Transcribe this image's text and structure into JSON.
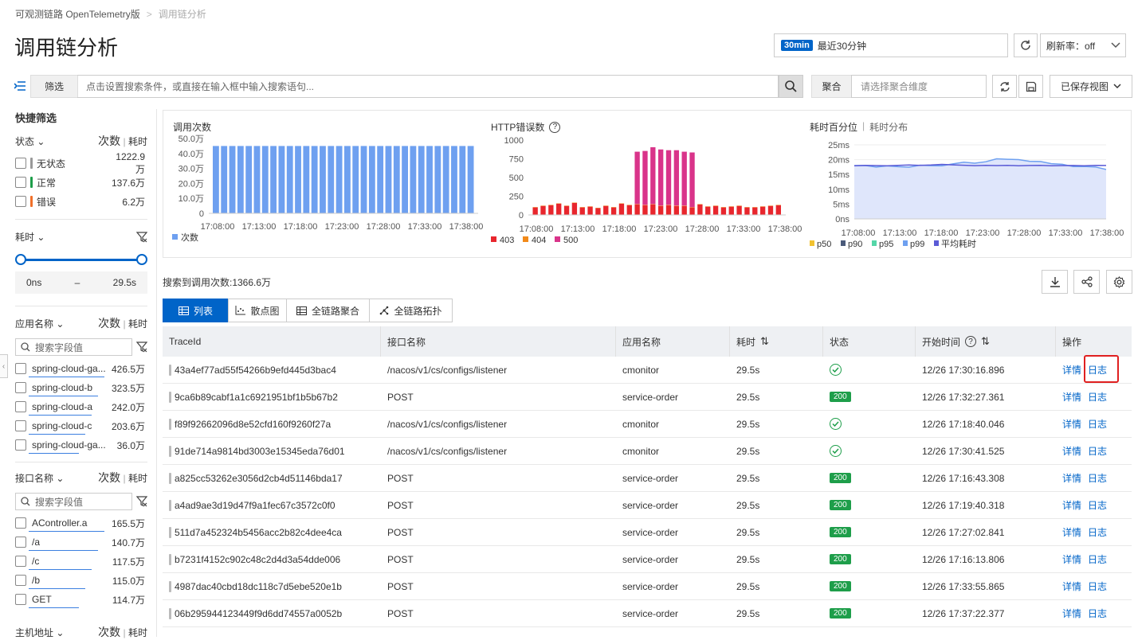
{
  "breadcrumb": {
    "parent": "可观测链路 OpenTelemetry版",
    "sep": ">",
    "current": "调用链分析"
  },
  "page_title": "调用链分析",
  "time": {
    "tag": "30min",
    "label": "最近30分钟"
  },
  "refresh_rate": {
    "label": "刷新率：off"
  },
  "search": {
    "filter_label": "筛选",
    "placeholder": "点击设置搜索条件，或直接在输入框中输入搜索语句..."
  },
  "aggregate": {
    "label": "聚合",
    "placeholder": "请选择聚合维度"
  },
  "saved_view": "已保存视图",
  "sidebar": {
    "title": "快捷筛选",
    "count_word": "次数",
    "sep": "|",
    "time_word": "耗时",
    "status": {
      "label": "状态",
      "items": [
        {
          "label": "无状态",
          "count": "1222.9万",
          "color": "#999999"
        },
        {
          "label": "正常",
          "count": "137.6万",
          "color": "#1e9e4a"
        },
        {
          "label": "错误",
          "count": "6.2万",
          "color": "#f0702a"
        }
      ]
    },
    "duration": {
      "label": "耗时",
      "min": "0ns",
      "dash": "–",
      "max": "29.5s"
    },
    "app": {
      "label": "应用名称",
      "search_placeholder": "搜索字段值",
      "items": [
        {
          "label": "spring-cloud-ga...",
          "count": "426.5万"
        },
        {
          "label": "spring-cloud-b",
          "count": "323.5万"
        },
        {
          "label": "spring-cloud-a",
          "count": "242.0万"
        },
        {
          "label": "spring-cloud-c",
          "count": "203.6万"
        },
        {
          "label": "spring-cloud-ga...",
          "count": "36.0万"
        }
      ]
    },
    "api": {
      "label": "接口名称",
      "search_placeholder": "搜索字段值",
      "items": [
        {
          "label": "AController.a",
          "count": "165.5万"
        },
        {
          "label": "/a",
          "count": "140.7万"
        },
        {
          "label": "/c",
          "count": "117.5万"
        },
        {
          "label": "/b",
          "count": "115.0万"
        },
        {
          "label": "GET",
          "count": "114.7万"
        }
      ]
    },
    "host": {
      "label": "主机地址"
    }
  },
  "charts": {
    "calls": {
      "title": "调用次数",
      "legend": "次数",
      "color": "#6ea0f0",
      "yticks": [
        "50.0万",
        "40.0万",
        "30.0万",
        "20.0万",
        "10.0万",
        "0"
      ],
      "xticks": [
        "17:08:00",
        "17:13:00",
        "17:18:00",
        "17:23:00",
        "17:28:00",
        "17:33:00",
        "17:38:00"
      ]
    },
    "errors": {
      "title": "HTTP错误数",
      "yticks": [
        "1000",
        "750",
        "500",
        "250",
        "0"
      ],
      "xticks": [
        "17:08:00",
        "17:13:00",
        "17:18:00",
        "17:23:00",
        "17:28:00",
        "17:33:00",
        "17:38:00"
      ],
      "legend": [
        {
          "name": "403",
          "color": "#e8262d"
        },
        {
          "name": "404",
          "color": "#f28a1a"
        },
        {
          "name": "500",
          "color": "#d9348a"
        }
      ]
    },
    "latency": {
      "title": "耗时百分位",
      "sep": "|",
      "alt": "耗时分布",
      "yticks": [
        "25ms",
        "20ms",
        "15ms",
        "10ms",
        "5ms",
        "0ns"
      ],
      "xticks": [
        "17:08:00",
        "17:13:00",
        "17:18:00",
        "17:23:00",
        "17:28:00",
        "17:33:00",
        "17:38:00"
      ],
      "legend": [
        {
          "name": "p50",
          "color": "#f2c230"
        },
        {
          "name": "p90",
          "color": "#4a5a7a"
        },
        {
          "name": "p95",
          "color": "#55d6a8"
        },
        {
          "name": "p99",
          "color": "#6ea0f0"
        },
        {
          "name": "平均耗时",
          "color": "#5b5bd6"
        }
      ]
    }
  },
  "chart_data": [
    {
      "type": "bar",
      "title": "调用次数",
      "x": [
        "17:07",
        "17:08",
        "17:09",
        "17:10",
        "17:11",
        "17:12",
        "17:13",
        "17:14",
        "17:15",
        "17:16",
        "17:17",
        "17:18",
        "17:19",
        "17:20",
        "17:21",
        "17:22",
        "17:23",
        "17:24",
        "17:25",
        "17:26",
        "17:27",
        "17:28",
        "17:29",
        "17:30",
        "17:31",
        "17:32",
        "17:33",
        "17:34",
        "17:35",
        "17:36",
        "17:37",
        "17:38"
      ],
      "series": [
        {
          "name": "次数",
          "values": [
            45,
            45,
            45,
            45,
            45,
            45,
            45,
            45,
            45,
            45,
            45,
            45,
            45,
            45,
            45,
            45,
            45,
            45,
            45,
            45,
            45,
            45,
            45,
            45,
            45,
            45,
            45,
            45,
            45,
            45,
            45,
            45
          ]
        }
      ],
      "ylim": [
        0,
        50
      ]
    },
    {
      "type": "bar",
      "title": "HTTP错误数",
      "x": [
        "17:07",
        "17:08",
        "17:09",
        "17:10",
        "17:11",
        "17:12",
        "17:13",
        "17:14",
        "17:15",
        "17:16",
        "17:17",
        "17:18",
        "17:19",
        "17:20",
        "17:21",
        "17:22",
        "17:23",
        "17:24",
        "17:25",
        "17:26",
        "17:27",
        "17:28",
        "17:29",
        "17:30",
        "17:31",
        "17:32",
        "17:33",
        "17:34",
        "17:35",
        "17:36",
        "17:37",
        "17:38"
      ],
      "series": [
        {
          "name": "403",
          "values": [
            100,
            120,
            130,
            150,
            120,
            160,
            100,
            110,
            90,
            120,
            100,
            150,
            130,
            140,
            130,
            140,
            120,
            130,
            120,
            120,
            100,
            140,
            110,
            120,
            100,
            110,
            120,
            100,
            100,
            110,
            120,
            130
          ]
        },
        {
          "name": "404",
          "values": [
            5,
            5,
            5,
            5,
            5,
            5,
            5,
            5,
            5,
            5,
            5,
            5,
            5,
            5,
            5,
            5,
            5,
            5,
            5,
            5,
            5,
            5,
            5,
            5,
            5,
            5,
            5,
            5,
            5,
            5,
            5,
            5
          ]
        },
        {
          "name": "500",
          "values": [
            0,
            0,
            0,
            0,
            0,
            0,
            0,
            0,
            0,
            0,
            0,
            0,
            0,
            700,
            720,
            760,
            750,
            730,
            740,
            720,
            730,
            0,
            0,
            0,
            0,
            0,
            0,
            0,
            0,
            0,
            0,
            0
          ]
        }
      ],
      "ylim": [
        0,
        1000
      ]
    },
    {
      "type": "area",
      "title": "耗时百分位",
      "x": [
        "17:07",
        "17:13",
        "17:18",
        "17:23",
        "17:28",
        "17:33",
        "17:38"
      ],
      "series": [
        {
          "name": "p50",
          "values": [
            0.5,
            0.5,
            0.5,
            0.5,
            0.5,
            0.5,
            0.5
          ]
        },
        {
          "name": "p90",
          "values": [
            2,
            2,
            2,
            2,
            2,
            2,
            2
          ]
        },
        {
          "name": "p95",
          "values": [
            3,
            3,
            3,
            3,
            3,
            3,
            3
          ]
        },
        {
          "name": "p99",
          "values": [
            18,
            17.5,
            18,
            19,
            20,
            18,
            17
          ]
        },
        {
          "name": "平均耗时",
          "values": [
            18,
            18,
            18.2,
            18,
            18,
            18,
            18
          ]
        }
      ],
      "ylim": [
        0,
        25
      ]
    }
  ],
  "result": {
    "label": "搜索到调用次数:1366.6万"
  },
  "tabs": [
    {
      "label": "列表"
    },
    {
      "label": "散点图"
    },
    {
      "label": "全链路聚合"
    },
    {
      "label": "全链路拓扑"
    }
  ],
  "table": {
    "headers": {
      "traceid": "TraceId",
      "api": "接口名称",
      "app": "应用名称",
      "dur": "耗时",
      "status": "状态",
      "start": "开始时间",
      "ops": "操作"
    },
    "detail": "详情",
    "log": "日志",
    "rows": [
      {
        "traceid": "43a4ef77ad55f54266b9efd445d3bac4",
        "api": "/nacos/v1/cs/configs/listener",
        "app": "cmonitor",
        "dur": "29.5s",
        "status": "ok",
        "start": "12/26 17:30:16.896"
      },
      {
        "traceid": "9ca6b89cabf1a1c6921951bf1b5b67b2",
        "api": "POST",
        "app": "service-order",
        "dur": "29.5s",
        "status": "200",
        "start": "12/26 17:32:27.361"
      },
      {
        "traceid": "f89f92662096d8e52cfd160f9260f27a",
        "api": "/nacos/v1/cs/configs/listener",
        "app": "cmonitor",
        "dur": "29.5s",
        "status": "ok",
        "start": "12/26 17:18:40.046"
      },
      {
        "traceid": "91de714a9814bd3003e15345eda76d01",
        "api": "/nacos/v1/cs/configs/listener",
        "app": "cmonitor",
        "dur": "29.5s",
        "status": "ok",
        "start": "12/26 17:30:41.525"
      },
      {
        "traceid": "a825cc53262e3056d2cb4d51146bda17",
        "api": "POST",
        "app": "service-order",
        "dur": "29.5s",
        "status": "200",
        "start": "12/26 17:16:43.308"
      },
      {
        "traceid": "a4ad9ae3d19d47f9a1fec67c3572c0f0",
        "api": "POST",
        "app": "service-order",
        "dur": "29.5s",
        "status": "200",
        "start": "12/26 17:19:40.318"
      },
      {
        "traceid": "511d7a452324b5456acc2b82c4dee4ca",
        "api": "POST",
        "app": "service-order",
        "dur": "29.5s",
        "status": "200",
        "start": "12/26 17:27:02.841"
      },
      {
        "traceid": "b7231f4152c902c48c2d4d3a54dde006",
        "api": "POST",
        "app": "service-order",
        "dur": "29.5s",
        "status": "200",
        "start": "12/26 17:16:13.806"
      },
      {
        "traceid": "4987dac40cbd18dc118c7d5ebe520e1b",
        "api": "POST",
        "app": "service-order",
        "dur": "29.5s",
        "status": "200",
        "start": "12/26 17:33:55.865"
      },
      {
        "traceid": "06b295944123449f9d6dd74557a0052b",
        "api": "POST",
        "app": "service-order",
        "dur": "29.5s",
        "status": "200",
        "start": "12/26 17:37:22.377"
      }
    ]
  }
}
